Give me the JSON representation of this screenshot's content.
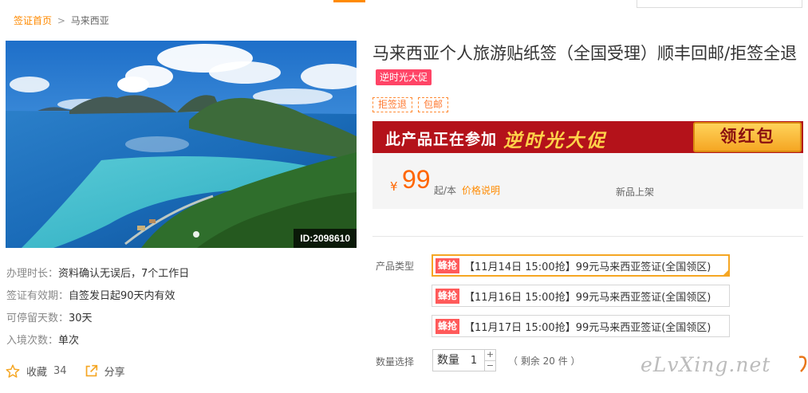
{
  "breadcrumb": {
    "home_label": "签证首页",
    "separator": ">",
    "current": "马来西亚"
  },
  "hero": {
    "image_id": "ID:2098610"
  },
  "info": [
    {
      "label": "办理时长：",
      "value": "资料确认无误后，7个工作日"
    },
    {
      "label": "签证有效期：",
      "value": "自签发日起90天内有效"
    },
    {
      "label": "可停留天数：",
      "value": "30天"
    },
    {
      "label": "入境次数：",
      "value": "单次"
    }
  ],
  "actions": {
    "favorite_label": "收藏",
    "favorite_count": "34",
    "share_label": "分享",
    "favorite_icon": "star-icon",
    "share_icon": "share-icon"
  },
  "product": {
    "title": "马来西亚个人旅游贴纸签（全国受理）顺丰回邮/拒签全退",
    "promo_badge": "逆时光大促",
    "tags": [
      "拒签退",
      "包邮"
    ]
  },
  "banner": {
    "text": "此产品正在参加",
    "promo": "逆时光大促",
    "button": "领红包"
  },
  "price": {
    "currency": "¥",
    "value": "99",
    "unit": "起/本",
    "explain": "价格说明",
    "new_label": "新品上架"
  },
  "options": {
    "type_label": "产品类型",
    "items": [
      {
        "badge": "蜂抢",
        "text": "【11月14日 15:00抢】99元马来西亚签证(全国领区)",
        "selected": true
      },
      {
        "badge": "蜂抢",
        "text": "【11月16日 15:00抢】99元马来西亚签证(全国领区)",
        "selected": false
      },
      {
        "badge": "蜂抢",
        "text": "【11月17日 15:00抢】99元马来西亚签证(全国领区)",
        "selected": false
      }
    ]
  },
  "quantity": {
    "label": "数量选择",
    "stepper_label": "数量",
    "value": "1",
    "plus": "+",
    "minus": "−",
    "stock": "（ 剩余 20 件 ）"
  },
  "watermark": {
    "text": "eLvXing.net"
  },
  "colors": {
    "accent": "#ff8a00",
    "price": "#ff6600",
    "banner_bg": "#b4121a",
    "badge": "#ff4466",
    "selected_border": "#f5a623"
  }
}
